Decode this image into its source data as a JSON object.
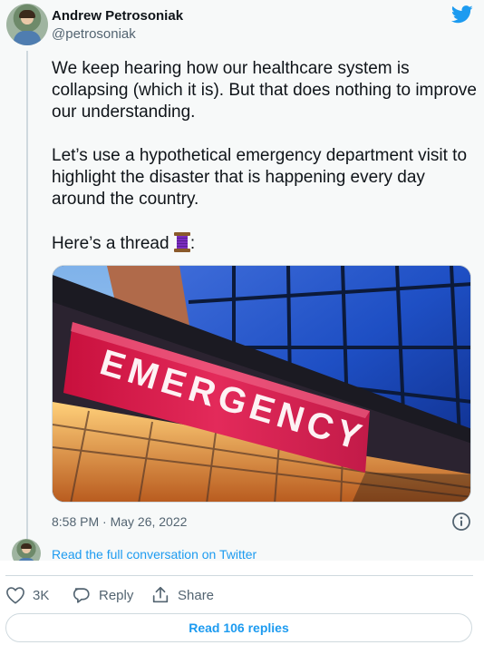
{
  "author": {
    "name": "Andrew Petrosoniak",
    "handle": "@petrosoniak"
  },
  "tweet": {
    "paragraph1": "We keep hearing how our healthcare system is collapsing (which it is). But that does nothing to improve our understanding.",
    "paragraph2": "Let’s use a hypothetical emergency department visit to highlight the disaster that is happening every day around the country.",
    "paragraph3": "Here’s a thread ",
    "paragraph3_suffix": ":",
    "thread_emoji_icon": "spool-of-thread-icon"
  },
  "media": {
    "sign_text": "EMERGENCY"
  },
  "meta": {
    "timestamp": "8:58 PM · May 26, 2022"
  },
  "conversation": {
    "link_label": "Read the full conversation on Twitter"
  },
  "actions": {
    "like_count": "3K",
    "reply_label": "Reply",
    "share_label": "Share"
  },
  "replies": {
    "button_label": "Read 106 replies"
  },
  "colors": {
    "link_blue": "#1d9bf0",
    "text": "#0f1419",
    "muted": "#536471",
    "sign_red": "#d81e4f"
  }
}
